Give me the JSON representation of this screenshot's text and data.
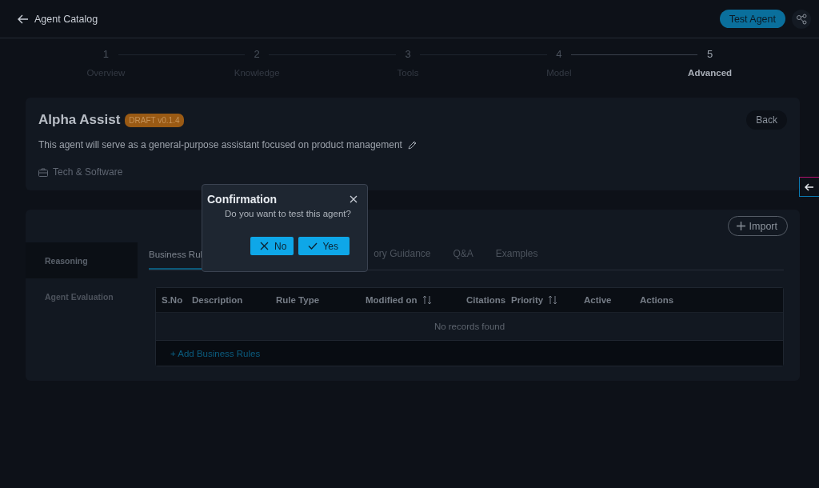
{
  "header": {
    "back_label": "Agent Catalog",
    "action_button": "Test Agent"
  },
  "steps": [
    {
      "number": "1",
      "label": "Overview",
      "selected": false
    },
    {
      "number": "2",
      "label": "Knowledge",
      "selected": false
    },
    {
      "number": "3",
      "label": "Tools",
      "selected": false
    },
    {
      "number": "4",
      "label": "Model",
      "selected": false
    },
    {
      "number": "5",
      "label": "Advanced",
      "selected": true
    }
  ],
  "agent": {
    "name": "Alpha Assist",
    "badge": "DRAFT v0.1.4",
    "description": "This agent will serve as a general-purpose assistant focused on product management",
    "category": "Tech & Software",
    "back_button": "Back"
  },
  "import_button": "Import",
  "side_nav": [
    {
      "label": "Reasoning",
      "selected": true
    },
    {
      "label": "Agent Evaluation",
      "selected": false
    }
  ],
  "tabs": [
    {
      "label": "Business Rul",
      "selected": true
    },
    {
      "label": "ory Guidance",
      "selected": false
    },
    {
      "label": "Q&A",
      "selected": false
    },
    {
      "label": "Examples",
      "selected": false
    }
  ],
  "table": {
    "columns": [
      {
        "label": "S.No",
        "sortable": false
      },
      {
        "label": "Description",
        "sortable": false
      },
      {
        "label": "Rule Type",
        "sortable": false
      },
      {
        "label": "Modified on",
        "sortable": true
      },
      {
        "label": "Citations",
        "sortable": false
      },
      {
        "label": "Priority",
        "sortable": true
      },
      {
        "label": "Active",
        "sortable": false
      },
      {
        "label": "Actions",
        "sortable": false
      }
    ],
    "empty_message": "No records found",
    "add_link": "+ Add Business Rules"
  },
  "dialog": {
    "title": "Confirmation",
    "message": "Do you want to test this agent?",
    "buttons": [
      {
        "label": "No",
        "kind": "cancel"
      },
      {
        "label": "Yes",
        "kind": "confirm"
      }
    ]
  }
}
